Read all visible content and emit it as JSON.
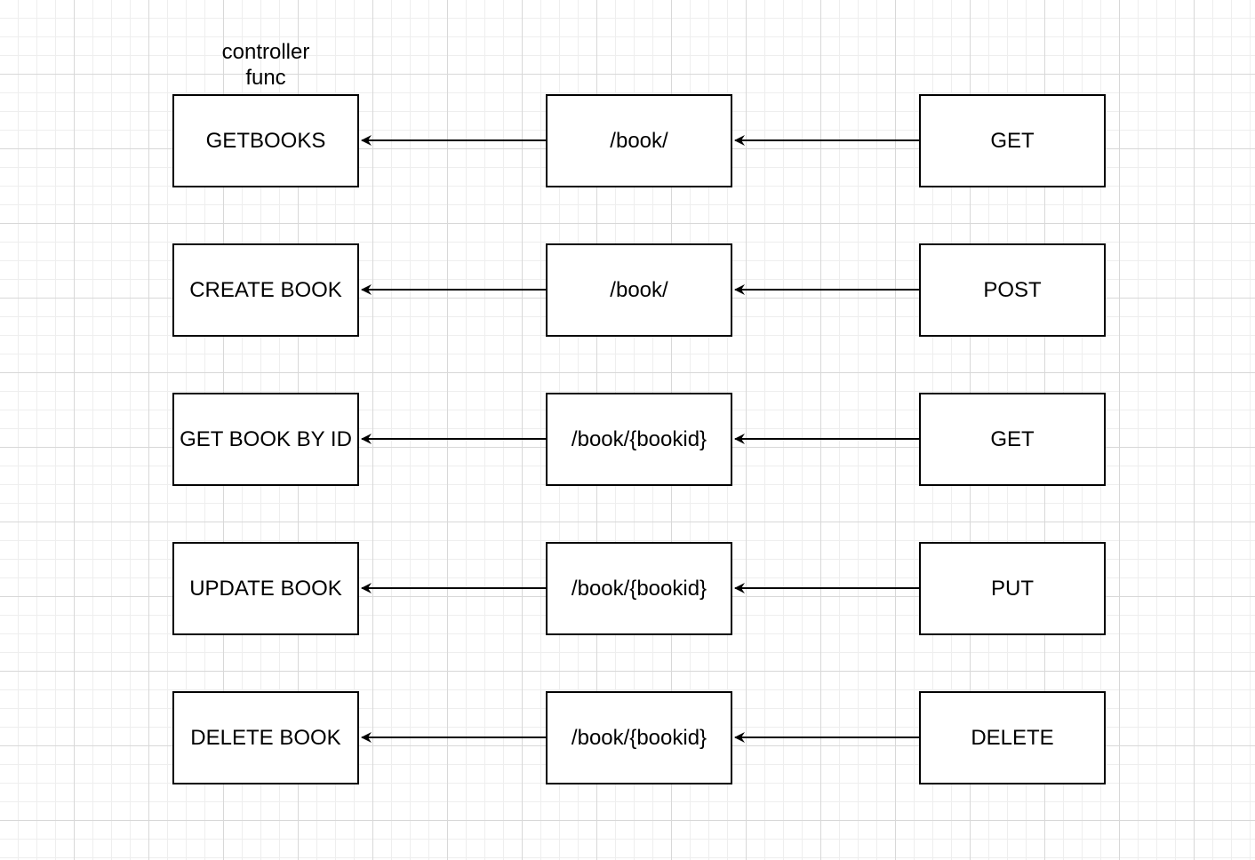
{
  "diagram": {
    "column_label": {
      "line1": "controller",
      "line2": "func"
    },
    "rows": [
      {
        "controller": "GETBOOKS",
        "route": "/book/",
        "method": "GET"
      },
      {
        "controller": "CREATE BOOK",
        "route": "/book/",
        "method": "POST"
      },
      {
        "controller": "GET BOOK BY ID",
        "route": "/book/{bookid}",
        "method": "GET"
      },
      {
        "controller": "UPDATE BOOK",
        "route": "/book/{bookid}",
        "method": "PUT"
      },
      {
        "controller": "DELETE BOOK",
        "route": "/book/{bookid}",
        "method": "DELETE"
      }
    ]
  },
  "colors": {
    "stroke": "#000000",
    "fill": "#ffffff",
    "grid": "#d8d8d8"
  }
}
